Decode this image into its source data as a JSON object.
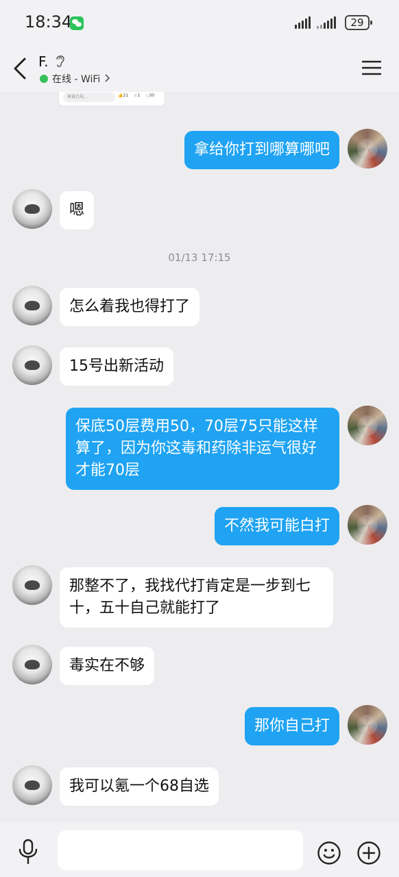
{
  "status_bar": {
    "time": "18:34",
    "battery": "29"
  },
  "header": {
    "contact_name": "F.",
    "online_status": "在线 - WiFi",
    "status_color": "#36c15b"
  },
  "shared_card": {
    "input_hint": "来说几句...",
    "likes": "21",
    "shares": "1",
    "comments": "30"
  },
  "messages": [
    {
      "side": "out",
      "text": "拿给你打到哪算哪吧"
    },
    {
      "side": "in",
      "text": "嗯"
    },
    {
      "side": "in",
      "text": "怎么着我也得打了"
    },
    {
      "side": "in",
      "text": "15号出新活动"
    },
    {
      "side": "out",
      "text": "保底50层费用50，70层75只能这样算了，因为你这毒和药除非运气很好才能70层"
    },
    {
      "side": "out",
      "text": "不然我可能白打"
    },
    {
      "side": "in",
      "text": "那整不了，我找代打肯定是一步到七十，五十自己就能打了"
    },
    {
      "side": "in",
      "text": "毒实在不够"
    },
    {
      "side": "out",
      "text": "那你自己打"
    },
    {
      "side": "in",
      "text": "我可以氪一个68自选"
    }
  ],
  "timestamp": "01/13 17:15",
  "input": {
    "placeholder": ""
  },
  "colors": {
    "bubble_out": "#1fa3f2",
    "bubble_in": "#ffffff",
    "background": "#ededf0"
  }
}
